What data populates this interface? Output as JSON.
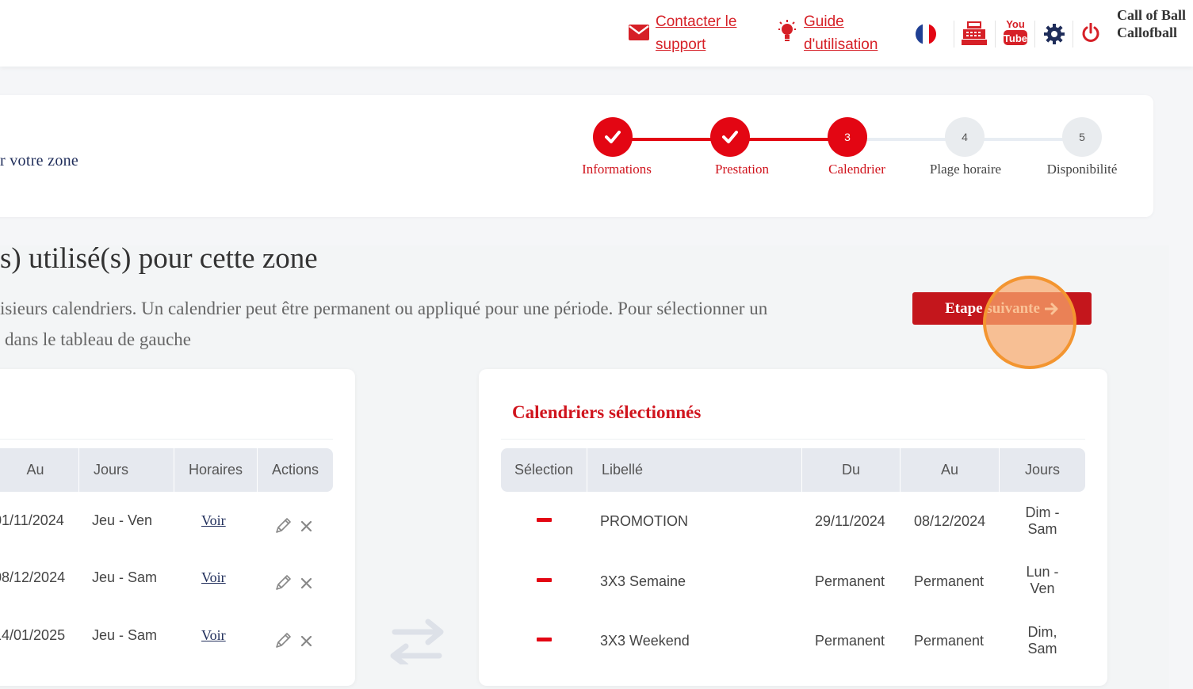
{
  "header": {
    "support_link": "Contacter le support",
    "guide_link": "Guide d'utilisation",
    "user_name": "Call of Ball Callofball"
  },
  "steps": [
    {
      "label": "Informations",
      "state": "done",
      "number": ""
    },
    {
      "label": "Prestation",
      "state": "done",
      "number": ""
    },
    {
      "label": "Calendrier",
      "state": "active",
      "number": "3"
    },
    {
      "label": "Plage horaire",
      "state": "todo",
      "number": "4"
    },
    {
      "label": "Disponibilité",
      "state": "todo",
      "number": "5"
    }
  ],
  "zone_text": "r votre zone",
  "main": {
    "title": "s) utilisé(s) pour cette zone",
    "desc_line1": "isieurs calendriers. Un calendrier peut être permanent ou appliqué pour une période. Pour sélectionner un",
    "desc_line2": "dans le tableau de gauche",
    "next_button": "Etape suivante"
  },
  "left_table": {
    "headers": [
      "Au",
      "Jours",
      "Horaires",
      "Actions"
    ],
    "rows": [
      {
        "au": "01/11/2024",
        "jours": "Jeu - Ven",
        "horaires": "Voir"
      },
      {
        "au": "08/12/2024",
        "jours": "Jeu - Sam",
        "horaires": "Voir"
      },
      {
        "au": "14/01/2025",
        "jours": "Jeu - Sam",
        "horaires": "Voir"
      }
    ]
  },
  "right_table": {
    "title": "Calendriers sélectionnés",
    "headers": [
      "Sélection",
      "Libellé",
      "Du",
      "Au",
      "Jours"
    ],
    "rows": [
      {
        "libelle": "PROMOTION",
        "du": "29/11/2024",
        "au": "08/12/2024",
        "jours": "Dim - Sam"
      },
      {
        "libelle": "3X3 Semaine",
        "du": "Permanent",
        "au": "Permanent",
        "jours": "Lun - Ven"
      },
      {
        "libelle": "3X3 Weekend",
        "du": "Permanent",
        "au": "Permanent",
        "jours": "Dim, Sam"
      }
    ]
  },
  "colors": {
    "brand_red": "#e30613",
    "button_red": "#c4161c",
    "highlight": "#f39530"
  }
}
